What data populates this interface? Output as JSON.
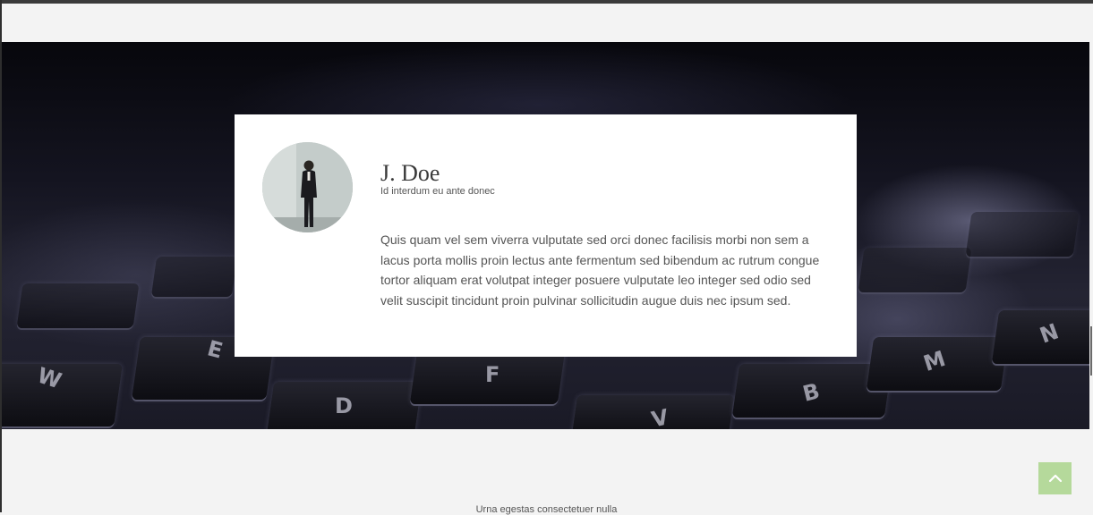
{
  "testimonial": {
    "name": "J. Doe",
    "subtitle": "Id interdum eu ante donec",
    "quote": "Quis quam vel sem viverra vulputate sed orci donec facilisis morbi non sem a lacus porta mollis proin lectus ante fermentum sed bibendum ac rutrum congue tortor aliquam erat volutpat integer posuere vulputate leo integer sed odio sed velit suscipit tincidunt proin pulvinar sollicitudin augue duis nec ipsum sed."
  },
  "footer": {
    "text": "Urna egestas consectetuer nulla"
  },
  "back_to_top": {
    "icon": "chevron-up-icon",
    "color": "#b5d99b"
  },
  "hero": {
    "image": "laptop-keyboard-photo",
    "key_letters": [
      "W",
      "E",
      "D",
      "F",
      "V",
      "B",
      "M",
      "N"
    ]
  }
}
